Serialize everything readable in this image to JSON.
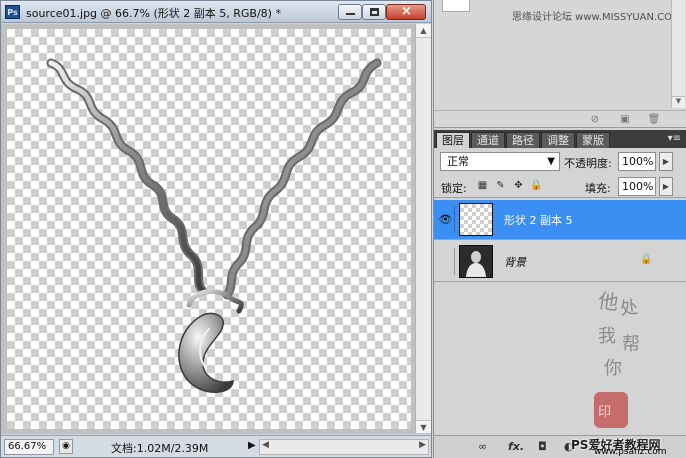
{
  "document": {
    "title": "source01.jpg @ 66.7% (形状 2 副本 5, RGB/8) *",
    "app_icon_text": "Ps",
    "zoom": "66.67%",
    "doc_info": "文档:1.02M/2.39M"
  },
  "panels": {
    "credit": "思缘设计论坛  www.MISSYUAN.COM",
    "tabs": [
      {
        "label": "图层",
        "active": true
      },
      {
        "label": "通道",
        "active": false
      },
      {
        "label": "路径",
        "active": false
      },
      {
        "label": "调整",
        "active": false
      },
      {
        "label": "蒙版",
        "active": false
      }
    ],
    "blend_mode": "正常",
    "opacity_label": "不透明度:",
    "opacity_value": "100%",
    "lock_label": "锁定:",
    "fill_label": "填充:",
    "fill_value": "100%",
    "layers": [
      {
        "name": "形状 2 副本 5",
        "selected": true,
        "visible": true
      },
      {
        "name": "背景",
        "selected": false,
        "visible": false,
        "locked": true
      }
    ]
  },
  "watermark": {
    "site": "PS爱好者教程网",
    "url": "www.psahz.com"
  },
  "colors": {
    "selected_layer": "#3b8ff2",
    "tab_bar": "#3c3c3c"
  }
}
